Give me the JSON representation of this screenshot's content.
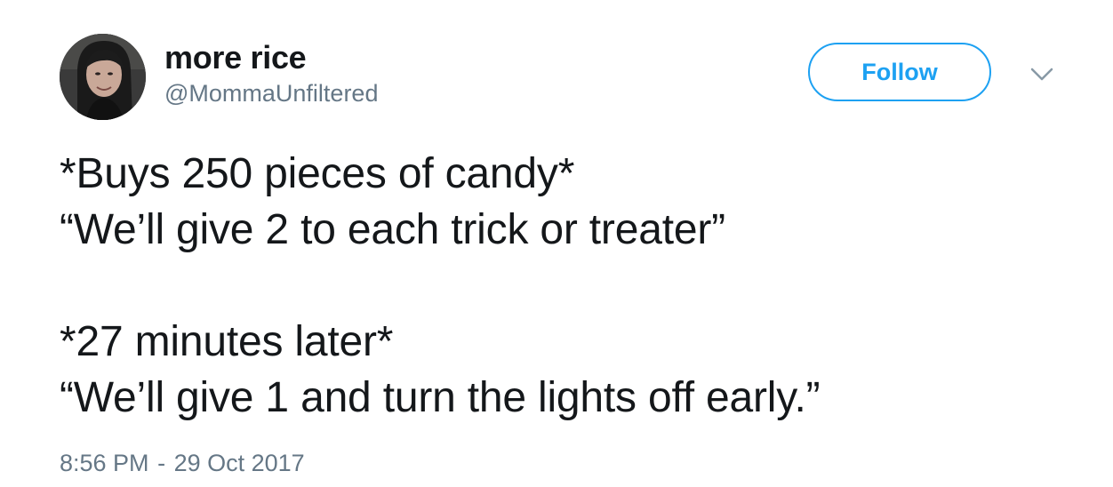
{
  "tweet": {
    "author": {
      "display_name": "more rice",
      "handle": "@MommaUnfiltered",
      "avatar_icon": "profile-photo"
    },
    "follow_label": "Follow",
    "menu_icon": "chevron-down-icon",
    "body_lines": [
      "*Buys 250 pieces of candy*",
      "“We’ll give 2 to each trick or treater”",
      "",
      "*27 minutes later*",
      "“We’ll give 1 and turn the lights off early.”"
    ],
    "time": "8:56 PM",
    "separator": "-",
    "date": "29 Oct 2017"
  },
  "colors": {
    "accent": "#1da1f2",
    "text": "#14171a",
    "muted": "#657786"
  }
}
